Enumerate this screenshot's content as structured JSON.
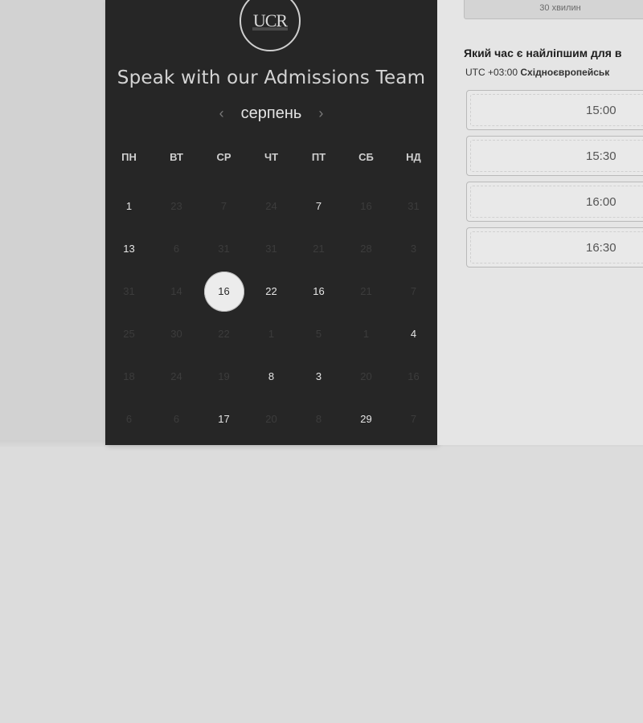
{
  "calendar": {
    "logo_text": "UCR",
    "title": "Speak with our Admissions Team",
    "month": "серпень",
    "prev_icon": "chevron-left-icon",
    "next_icon": "chevron-right-icon",
    "weekdays": [
      "ПН",
      "ВТ",
      "СР",
      "ЧТ",
      "ПТ",
      "СБ",
      "НД"
    ],
    "weeks": [
      [
        {
          "d": "1",
          "active": true
        },
        {
          "d": "23",
          "active": false
        },
        {
          "d": "7",
          "active": false
        },
        {
          "d": "24",
          "active": false
        },
        {
          "d": "7",
          "active": true
        },
        {
          "d": "16",
          "active": false
        },
        {
          "d": "31",
          "active": false
        }
      ],
      [
        {
          "d": "13",
          "active": true
        },
        {
          "d": "6",
          "active": false
        },
        {
          "d": "31",
          "active": false
        },
        {
          "d": "31",
          "active": false
        },
        {
          "d": "21",
          "active": false
        },
        {
          "d": "28",
          "active": false
        },
        {
          "d": "3",
          "active": false
        }
      ],
      [
        {
          "d": "31",
          "active": false
        },
        {
          "d": "14",
          "active": false
        },
        {
          "d": "16",
          "active": true,
          "selected": true
        },
        {
          "d": "22",
          "active": true
        },
        {
          "d": "16",
          "active": true
        },
        {
          "d": "21",
          "active": false
        },
        {
          "d": "7",
          "active": false
        }
      ],
      [
        {
          "d": "25",
          "active": false
        },
        {
          "d": "30",
          "active": false
        },
        {
          "d": "22",
          "active": false
        },
        {
          "d": "1",
          "active": false
        },
        {
          "d": "5",
          "active": false
        },
        {
          "d": "1",
          "active": false
        },
        {
          "d": "4",
          "active": true
        }
      ],
      [
        {
          "d": "18",
          "active": false
        },
        {
          "d": "24",
          "active": false
        },
        {
          "d": "19",
          "active": false
        },
        {
          "d": "8",
          "active": true
        },
        {
          "d": "3",
          "active": true
        },
        {
          "d": "20",
          "active": false
        },
        {
          "d": "16",
          "active": false
        }
      ],
      [
        {
          "d": "6",
          "active": false
        },
        {
          "d": "6",
          "active": false
        },
        {
          "d": "17",
          "active": true
        },
        {
          "d": "20",
          "active": false
        },
        {
          "d": "8",
          "active": false
        },
        {
          "d": "29",
          "active": true
        },
        {
          "d": "7",
          "active": false
        }
      ]
    ]
  },
  "booking": {
    "duration": "30 хвилин",
    "question": "Який час є найліпшим для в",
    "timezone_offset": "UTC +03:00",
    "timezone_name": "Східноєвропейськ",
    "slots": [
      "15:00",
      "15:30",
      "16:00",
      "16:30"
    ]
  },
  "colors": {
    "panel_dark": "#262626",
    "panel_light": "#e5e5e5",
    "page_bg": "#dcdcdc",
    "selected_day_bg": "#ececec"
  }
}
